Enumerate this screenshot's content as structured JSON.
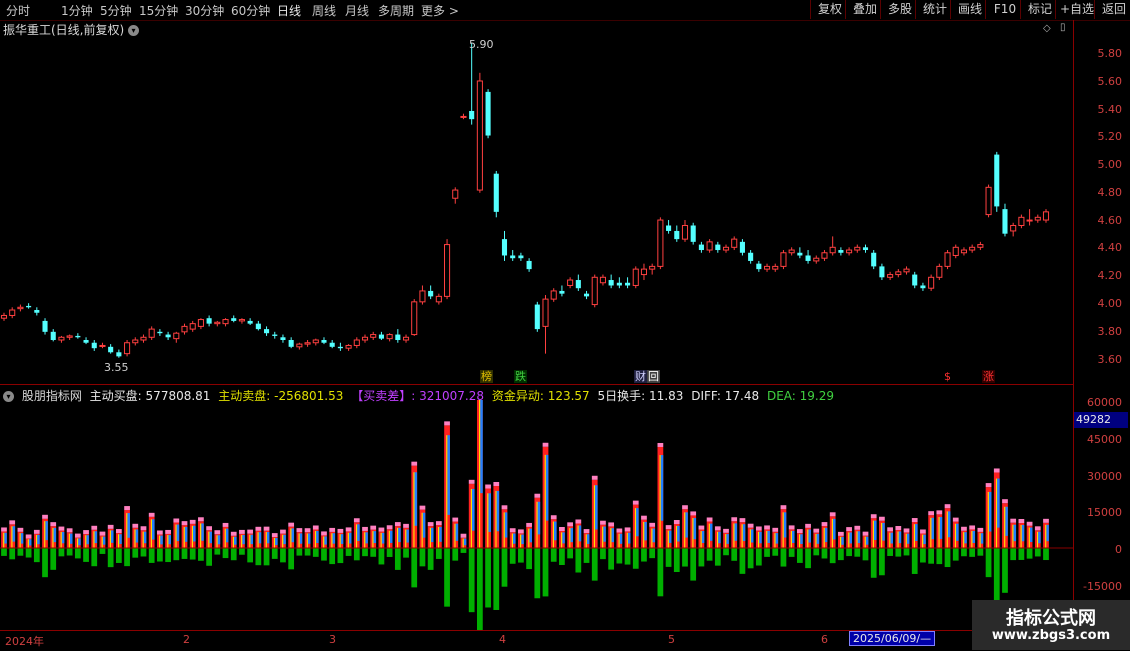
{
  "toolbar": {
    "periods": [
      "分时",
      "1分钟",
      "5分钟",
      "15分钟",
      "30分钟",
      "60分钟",
      "日线",
      "周线",
      "月线",
      "多周期",
      "更多 >"
    ],
    "active": "日线",
    "buttons": [
      "复权",
      "叠加",
      "多股",
      "统计",
      "画线",
      "F10",
      "标记",
      "+自选",
      "返回"
    ]
  },
  "stock": {
    "title": "振华重工(日线,前复权)"
  },
  "price_axis": [
    "5.80",
    "5.60",
    "5.40",
    "5.20",
    "5.00",
    "4.80",
    "4.60",
    "4.40",
    "4.20",
    "4.00",
    "3.80",
    "3.60"
  ],
  "highlights": {
    "high": "5.90",
    "low": "3.55"
  },
  "events": [
    {
      "label": "榜",
      "color": "#e0c000",
      "bg": "#303000"
    },
    {
      "label": "跌",
      "color": "#40d040",
      "bg": "#003000"
    },
    {
      "label": "财",
      "color": "#d0d0ff",
      "bg": "#202040"
    },
    {
      "label": "回",
      "color": "#ffffff",
      "bg": "#404040"
    },
    {
      "label": "$",
      "color": "#ff3030",
      "bg": "#000"
    },
    {
      "label": "涨",
      "color": "#ff3030",
      "bg": "#300000"
    }
  ],
  "indicator": {
    "name": "股朋指标网",
    "buy_label": "主动买盘:",
    "buy_value": "577808.81",
    "sell_label": "主动卖盘:",
    "sell_value": "-256801.53",
    "diff_label": "【买卖差】:",
    "diff_value": "321007.28",
    "money_label": "资金异动:",
    "money_value": "123.57",
    "turnover_label": "5日换手:",
    "turnover_value": "11.83",
    "diffk_label": "DIFF:",
    "diffk_value": "17.48",
    "dea_label": "DEA:",
    "dea_value": "19.29",
    "axis": [
      "60000",
      "45000",
      "30000",
      "15000",
      "0",
      "-15000"
    ],
    "current": "49282"
  },
  "dates": {
    "labels": [
      "2024年",
      "2",
      "3",
      "4",
      "5",
      "6"
    ],
    "selected": "2025/06/09/—"
  },
  "watermark": {
    "line1": "指标公式网",
    "line2": "www.zbgs3.com"
  },
  "colors": {
    "up": "#ff4040",
    "down": "#54ffff",
    "grid": "#8a0000"
  },
  "chart_data": {
    "type": "candlestick",
    "title": "振华重工(日线,前复权)",
    "ylim": [
      3.5,
      5.95
    ],
    "high": 5.9,
    "low": 3.55,
    "candles_ohlc": [
      [
        3.88,
        3.92,
        3.86,
        3.9
      ],
      [
        3.9,
        3.96,
        3.88,
        3.94
      ],
      [
        3.95,
        3.98,
        3.93,
        3.96
      ],
      [
        3.97,
        3.99,
        3.95,
        3.96
      ],
      [
        3.94,
        3.96,
        3.9,
        3.92
      ],
      [
        3.86,
        3.88,
        3.76,
        3.78
      ],
      [
        3.78,
        3.8,
        3.71,
        3.72
      ],
      [
        3.72,
        3.75,
        3.7,
        3.74
      ],
      [
        3.74,
        3.76,
        3.72,
        3.75
      ],
      [
        3.75,
        3.77,
        3.73,
        3.74
      ],
      [
        3.72,
        3.74,
        3.69,
        3.7
      ],
      [
        3.7,
        3.72,
        3.64,
        3.66
      ],
      [
        3.68,
        3.7,
        3.66,
        3.68
      ],
      [
        3.67,
        3.69,
        3.62,
        3.63
      ],
      [
        3.63,
        3.65,
        3.59,
        3.6
      ],
      [
        3.62,
        3.72,
        3.6,
        3.7
      ],
      [
        3.7,
        3.74,
        3.68,
        3.72
      ],
      [
        3.72,
        3.76,
        3.7,
        3.74
      ],
      [
        3.74,
        3.82,
        3.72,
        3.8
      ],
      [
        3.78,
        3.8,
        3.75,
        3.77
      ],
      [
        3.76,
        3.78,
        3.72,
        3.74
      ],
      [
        3.73,
        3.78,
        3.7,
        3.77
      ],
      [
        3.78,
        3.84,
        3.76,
        3.82
      ],
      [
        3.8,
        3.86,
        3.78,
        3.84
      ],
      [
        3.82,
        3.88,
        3.8,
        3.87
      ],
      [
        3.88,
        3.9,
        3.82,
        3.84
      ],
      [
        3.84,
        3.86,
        3.82,
        3.85
      ],
      [
        3.84,
        3.88,
        3.82,
        3.87
      ],
      [
        3.88,
        3.9,
        3.85,
        3.86
      ],
      [
        3.86,
        3.88,
        3.84,
        3.87
      ],
      [
        3.86,
        3.88,
        3.83,
        3.84
      ],
      [
        3.84,
        3.86,
        3.79,
        3.8
      ],
      [
        3.8,
        3.82,
        3.75,
        3.77
      ],
      [
        3.76,
        3.78,
        3.73,
        3.75
      ],
      [
        3.74,
        3.76,
        3.7,
        3.72
      ],
      [
        3.72,
        3.74,
        3.66,
        3.67
      ],
      [
        3.67,
        3.7,
        3.65,
        3.69
      ],
      [
        3.69,
        3.72,
        3.67,
        3.7
      ],
      [
        3.7,
        3.73,
        3.68,
        3.72
      ],
      [
        3.72,
        3.74,
        3.69,
        3.7
      ],
      [
        3.7,
        3.72,
        3.66,
        3.67
      ],
      [
        3.67,
        3.7,
        3.64,
        3.66
      ],
      [
        3.66,
        3.69,
        3.64,
        3.68
      ],
      [
        3.68,
        3.74,
        3.66,
        3.72
      ],
      [
        3.72,
        3.76,
        3.7,
        3.74
      ],
      [
        3.74,
        3.78,
        3.72,
        3.76
      ],
      [
        3.76,
        3.78,
        3.72,
        3.73
      ],
      [
        3.73,
        3.77,
        3.71,
        3.76
      ],
      [
        3.76,
        3.8,
        3.7,
        3.72
      ],
      [
        3.72,
        3.76,
        3.7,
        3.74
      ],
      [
        3.76,
        4.02,
        3.75,
        4.0
      ],
      [
        4.0,
        4.12,
        3.98,
        4.08
      ],
      [
        4.08,
        4.12,
        4.02,
        4.04
      ],
      [
        4.0,
        4.06,
        3.98,
        4.04
      ],
      [
        4.04,
        4.46,
        4.02,
        4.42
      ],
      [
        4.76,
        4.84,
        4.72,
        4.82
      ],
      [
        5.36,
        5.38,
        5.34,
        5.36
      ],
      [
        5.4,
        5.9,
        5.3,
        5.34
      ],
      [
        4.82,
        5.68,
        4.8,
        5.62
      ],
      [
        5.54,
        5.56,
        5.2,
        5.22
      ],
      [
        4.94,
        4.96,
        4.62,
        4.66
      ],
      [
        4.46,
        4.52,
        4.3,
        4.34
      ],
      [
        4.34,
        4.38,
        4.3,
        4.32
      ],
      [
        4.34,
        4.36,
        4.3,
        4.32
      ],
      [
        4.3,
        4.32,
        4.22,
        4.24
      ],
      [
        3.98,
        4.0,
        3.78,
        3.8
      ],
      [
        3.82,
        4.05,
        3.62,
        4.02
      ],
      [
        4.02,
        4.1,
        4.0,
        4.08
      ],
      [
        4.08,
        4.12,
        4.04,
        4.06
      ],
      [
        4.12,
        4.18,
        4.1,
        4.16
      ],
      [
        4.16,
        4.2,
        4.08,
        4.1
      ],
      [
        4.06,
        4.08,
        4.02,
        4.04
      ],
      [
        3.98,
        4.2,
        3.96,
        4.18
      ],
      [
        4.14,
        4.2,
        4.12,
        4.18
      ],
      [
        4.16,
        4.2,
        4.1,
        4.12
      ],
      [
        4.14,
        4.18,
        4.1,
        4.12
      ],
      [
        4.14,
        4.18,
        4.1,
        4.12
      ],
      [
        4.12,
        4.26,
        4.1,
        4.24
      ],
      [
        4.2,
        4.28,
        4.16,
        4.24
      ],
      [
        4.24,
        4.28,
        4.2,
        4.26
      ],
      [
        4.26,
        4.62,
        4.24,
        4.6
      ],
      [
        4.56,
        4.6,
        4.5,
        4.52
      ],
      [
        4.52,
        4.56,
        4.44,
        4.46
      ],
      [
        4.46,
        4.6,
        4.44,
        4.56
      ],
      [
        4.56,
        4.58,
        4.42,
        4.44
      ],
      [
        4.42,
        4.44,
        4.36,
        4.38
      ],
      [
        4.38,
        4.46,
        4.36,
        4.44
      ],
      [
        4.42,
        4.44,
        4.36,
        4.38
      ],
      [
        4.38,
        4.42,
        4.36,
        4.4
      ],
      [
        4.4,
        4.48,
        4.38,
        4.46
      ],
      [
        4.44,
        4.46,
        4.34,
        4.36
      ],
      [
        4.36,
        4.38,
        4.28,
        4.3
      ],
      [
        4.28,
        4.3,
        4.22,
        4.24
      ],
      [
        4.24,
        4.28,
        4.22,
        4.26
      ],
      [
        4.24,
        4.28,
        4.22,
        4.26
      ],
      [
        4.26,
        4.38,
        4.24,
        4.36
      ],
      [
        4.36,
        4.4,
        4.34,
        4.38
      ],
      [
        4.36,
        4.4,
        4.32,
        4.34
      ],
      [
        4.34,
        4.38,
        4.28,
        4.3
      ],
      [
        4.3,
        4.34,
        4.28,
        4.32
      ],
      [
        4.32,
        4.38,
        4.3,
        4.36
      ],
      [
        4.36,
        4.48,
        4.34,
        4.4
      ],
      [
        4.38,
        4.4,
        4.34,
        4.36
      ],
      [
        4.36,
        4.4,
        4.34,
        4.38
      ],
      [
        4.38,
        4.42,
        4.36,
        4.4
      ],
      [
        4.4,
        4.42,
        4.36,
        4.38
      ],
      [
        4.36,
        4.38,
        4.24,
        4.26
      ],
      [
        4.26,
        4.28,
        4.16,
        4.18
      ],
      [
        4.18,
        4.22,
        4.16,
        4.2
      ],
      [
        4.2,
        4.24,
        4.18,
        4.22
      ],
      [
        4.22,
        4.26,
        4.2,
        4.24
      ],
      [
        4.2,
        4.22,
        4.1,
        4.12
      ],
      [
        4.12,
        4.14,
        4.08,
        4.1
      ],
      [
        4.1,
        4.2,
        4.08,
        4.18
      ],
      [
        4.18,
        4.28,
        4.16,
        4.26
      ],
      [
        4.26,
        4.38,
        4.24,
        4.36
      ],
      [
        4.34,
        4.42,
        4.32,
        4.4
      ],
      [
        4.36,
        4.4,
        4.34,
        4.38
      ],
      [
        4.38,
        4.42,
        4.36,
        4.4
      ],
      [
        4.4,
        4.44,
        4.38,
        4.42
      ],
      [
        4.64,
        4.86,
        4.62,
        4.84
      ],
      [
        5.08,
        5.1,
        4.66,
        4.7
      ],
      [
        4.68,
        4.72,
        4.48,
        4.5
      ],
      [
        4.52,
        4.58,
        4.48,
        4.56
      ],
      [
        4.56,
        4.64,
        4.54,
        4.62
      ],
      [
        4.6,
        4.68,
        4.56,
        4.6
      ],
      [
        4.6,
        4.64,
        4.58,
        4.62
      ],
      [
        4.6,
        4.68,
        4.58,
        4.66
      ]
    ],
    "indicator_series": [
      {
        "name": "主动买盘",
        "color": "#ff4040"
      },
      {
        "name": "主动卖盘",
        "color": "#00c000"
      }
    ]
  }
}
